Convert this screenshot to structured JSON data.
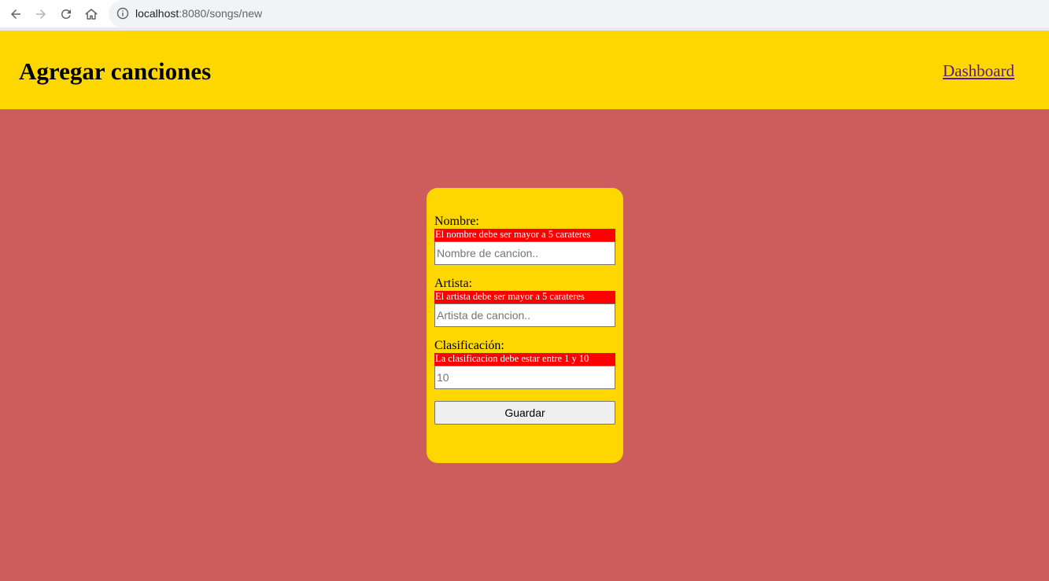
{
  "browser": {
    "url_host": "localhost",
    "url_rest": ":8080/songs/new"
  },
  "header": {
    "title": "Agregar canciones",
    "link": "Dashboard"
  },
  "form": {
    "fields": [
      {
        "label": "Nombre:",
        "error": "El nombre debe ser mayor a 5 carateres",
        "placeholder": "Nombre de cancion..",
        "value": ""
      },
      {
        "label": "Artista:",
        "error": "El artista debe ser mayor a 5 carateres",
        "placeholder": "Artista de cancion..",
        "value": ""
      },
      {
        "label": "Clasificación:",
        "error": "La clasificacion debe estar entre 1 y 10",
        "placeholder": "10",
        "value": ""
      }
    ],
    "submit_label": "Guardar"
  },
  "colors": {
    "page_bg": "#cd5c5c",
    "accent": "#ffd700",
    "error_bg": "#ff0000",
    "link": "#551a8b"
  }
}
